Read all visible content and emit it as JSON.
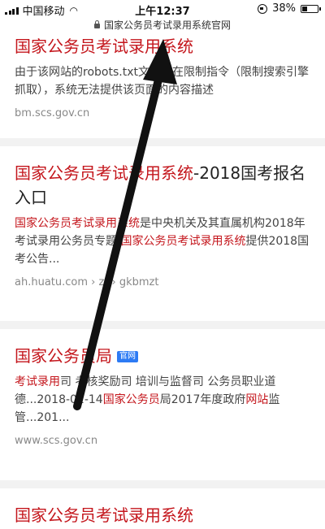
{
  "status_bar": {
    "carrier": "中国移动",
    "time": "上午12:37",
    "battery": "38%",
    "battery_level": 0.38
  },
  "url_bar": {
    "host": "国家公务员考试录用系统官网"
  },
  "results": [
    {
      "title": "国家公务员考试录用系统",
      "snippet": "由于该网站的robots.txt文件存在限制指令（限制搜索引擎抓取），系统无法提供该页面的内容描述",
      "url": "bm.scs.gov.cn"
    },
    {
      "title_hl": "国家公务员考试录用系统",
      "title_rest": "-2018国考报名入口",
      "snippet_a": "国家公务员考试录用系统",
      "snippet_b": "是中央机关及其直属机构2018年考试录用公务员专题,",
      "snippet_c": "国家公务员考试录用系统",
      "snippet_d": "提供2018国考公告...",
      "url": "ah.huatu.com › zt › gkbmzt"
    },
    {
      "title": "国家公务员局",
      "badge": "官网",
      "snippet_a": "考试录用",
      "snippet_b": "司 考核奖励司 培训与监督司 公务员职业道德...2018-02-14",
      "snippet_c": "国家公务员",
      "snippet_d": "局2017年度政府",
      "snippet_e": "网站",
      "snippet_f": "监管...201...",
      "url": "www.scs.gov.cn"
    },
    {
      "title": "国家公务员考试录用系统"
    }
  ],
  "overlay": {
    "arrow_color": "#111111"
  }
}
